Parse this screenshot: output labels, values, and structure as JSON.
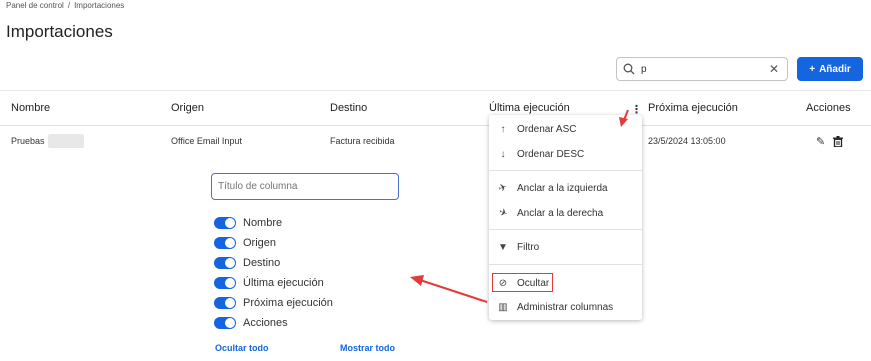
{
  "breadcrumb": {
    "home": "Panel de control",
    "separator": "/",
    "current": "Importaciones"
  },
  "page_title": "Importaciones",
  "search": {
    "value": "p",
    "icon": "search-icon"
  },
  "add_button": {
    "label": "Añadir",
    "icon": "plus-icon"
  },
  "columns": [
    "Nombre",
    "Origen",
    "Destino",
    "Última ejecución",
    "Próxima ejecución",
    "Acciones"
  ],
  "row": {
    "nombre": "Pruebas",
    "origen": "Office Email Input",
    "destino": "Factura recibida",
    "proxima": "23/5/2024 13:05:00"
  },
  "column_panel": {
    "placeholder": "Título de columna",
    "toggles": [
      "Nombre",
      "Origen",
      "Destino",
      "Última ejecución",
      "Próxima ejecución",
      "Acciones"
    ],
    "hide_all": "Ocultar todo",
    "show_all": "Mostrar todo"
  },
  "menu": {
    "sort_asc": "Ordenar ASC",
    "sort_desc": "Ordenar DESC",
    "pin_left": "Anclar a la izquierda",
    "pin_right": "Anclar a la derecha",
    "filter": "Filtro",
    "hide": "Ocultar",
    "manage": "Administrar columnas"
  },
  "colors": {
    "accent": "#1565e0",
    "annotation": "#e23b3b"
  }
}
